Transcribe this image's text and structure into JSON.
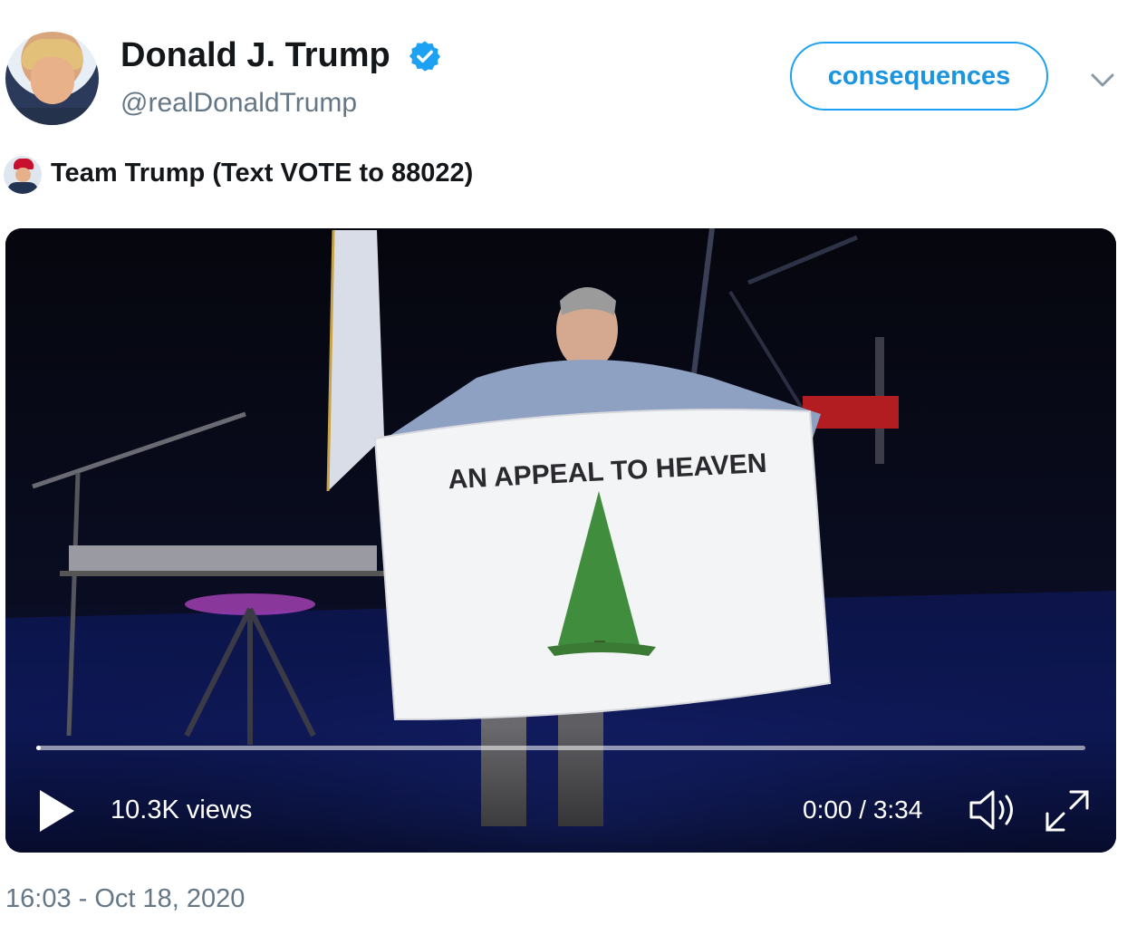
{
  "header": {
    "display_name": "Donald J. Trump",
    "handle": "@realDonaldTrump",
    "follow_button_label": "consequences",
    "verified_color": "#1da1f2"
  },
  "retweet": {
    "label": "Team Trump (Text VOTE to 88022)"
  },
  "video": {
    "flag_text": "AN APPEAL TO HEAVEN",
    "views": "10.3K views",
    "time_display": "0:00 / 3:34",
    "progress": 0.004
  },
  "tweet": {
    "timestamp": "16:03 - Oct 18, 2020"
  },
  "colors": {
    "accent": "#1da1f2",
    "secondary_text": "#657786"
  }
}
